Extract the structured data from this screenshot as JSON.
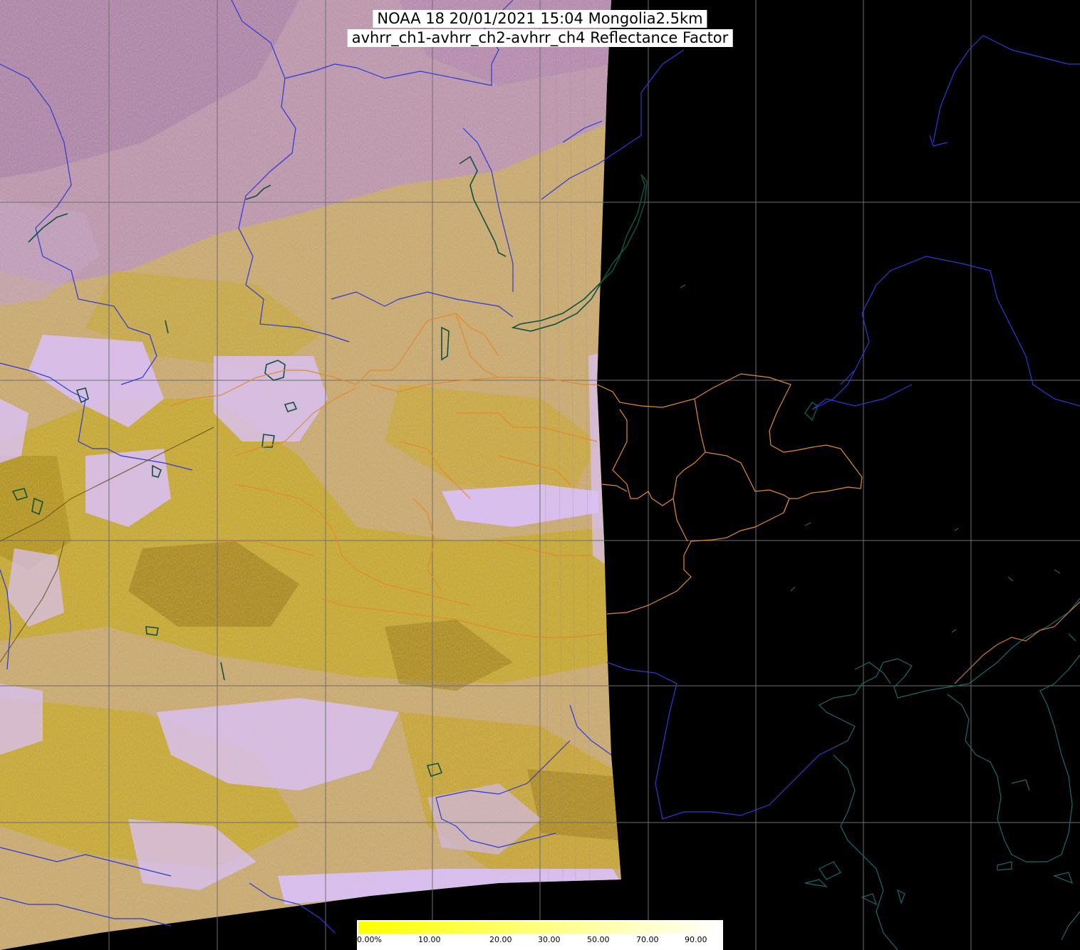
{
  "title": {
    "line1": "NOAA 18 20/01/2021 15:04 Mongolia2.5km",
    "line2": "avhrr_ch1-avhrr_ch2-avhrr_ch4 Reflectance Factor"
  },
  "colorbar": {
    "labels": [
      "0.00%",
      "10.00",
      "20.00",
      "30.00",
      "50.00",
      "70.00",
      "90.00"
    ],
    "colors": [
      "#ffff00",
      "#ffff40",
      "#ffff80",
      "#ffffc0",
      "#ffffff"
    ]
  },
  "colors": {
    "background": "#000000",
    "land_base": "#c8aa70",
    "land_yellow": "#c4a820",
    "land_dark": "#9a7a18",
    "cloud_lilac": "#d8c0ff",
    "cloud_mauve": "#b090b8",
    "rivers": "#2030d0",
    "lakes": "#104840",
    "province_borders": "#e08020",
    "coastlines": "#1a6060",
    "grid": "#707070"
  }
}
